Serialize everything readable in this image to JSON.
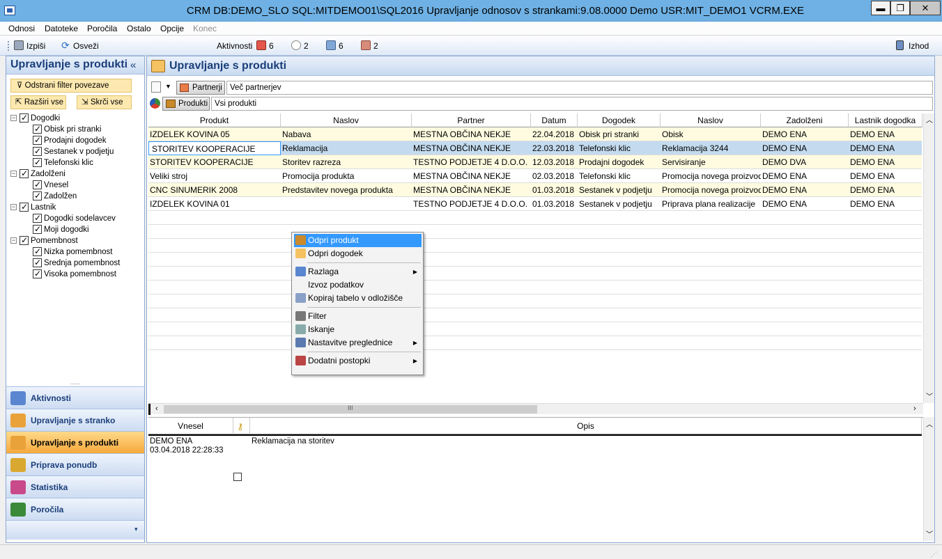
{
  "window": {
    "title": "CRM   DB:DEMO_SLO   SQL:MITDEMO01\\SQL2016   Upravljanje odnosov s strankami:9.08.0000   Demo   USR:MIT_DEMO1   VCRM.EXE",
    "min": "▬",
    "max": "❐",
    "close": "✕"
  },
  "menu": [
    "Odnosi",
    "Datoteke",
    "Poročila",
    "Ostalo",
    "Opcije",
    "Konec"
  ],
  "toolbar": {
    "print": "Izpiši",
    "refresh": "Osveži",
    "activities": "Aktivnosti",
    "count1": "6",
    "count2": "2",
    "count3": "6",
    "count4": "2",
    "exit": "Izhod"
  },
  "left": {
    "title": "Upravljanje s produkti",
    "collapse": "«",
    "remove_filter": "Odstrani filter povezave",
    "expand_all": "Razširi vse",
    "collapse_all": "Skrči vse",
    "tree": [
      {
        "label": "Dogodki",
        "level": 0
      },
      {
        "label": "Obisk pri stranki",
        "level": 1
      },
      {
        "label": "Prodajni dogodek",
        "level": 1
      },
      {
        "label": "Sestanek v podjetju",
        "level": 1
      },
      {
        "label": "Telefonski klic",
        "level": 1
      },
      {
        "label": "Zadolženi",
        "level": 0
      },
      {
        "label": "Vnesel",
        "level": 1
      },
      {
        "label": "Zadolžen",
        "level": 1
      },
      {
        "label": "Lastnik",
        "level": 0
      },
      {
        "label": "Dogodki sodelavcev",
        "level": 1
      },
      {
        "label": "Moji dogodki",
        "level": 1
      },
      {
        "label": "Pomembnost",
        "level": 0
      },
      {
        "label": "Nizka pomembnost",
        "level": 1
      },
      {
        "label": "Srednja pomembnost",
        "level": 1
      },
      {
        "label": "Visoka pomembnost",
        "level": 1
      }
    ],
    "splitter": "......",
    "nav": [
      "Aktivnosti",
      "Upravljanje s stranko",
      "Upravljanje s produkti",
      "Priprava ponudb",
      "Statistika",
      "Poročila"
    ],
    "more": "▾"
  },
  "main": {
    "title": "Upravljanje s produkti",
    "partners_btn": "Partnerji",
    "partners_val": "Več partnerjev",
    "products_btn": "Produkti",
    "products_val": "Vsi produkti",
    "columns": [
      "Produkt",
      "Naslov",
      "Partner",
      "Datum",
      "Dogodek",
      "Naslov",
      "Zadolženi",
      "Lastnik dogodka"
    ],
    "rows": [
      [
        "IZDELEK KOVINA 05",
        "Nabava",
        "MESTNA OBČINA NEKJE",
        "22.04.2018",
        "Obisk pri stranki",
        "Obisk",
        "DEMO ENA",
        "DEMO ENA"
      ],
      [
        "STORITEV KOOPERACIJE",
        "Reklamacija",
        "MESTNA OBČINA NEKJE",
        "22.03.2018",
        "Telefonski klic",
        "Reklamacija 3244",
        "DEMO ENA",
        "DEMO ENA"
      ],
      [
        "STORITEV KOOPERACIJE",
        "Storitev razreza",
        "TESTNO PODJETJE 4 D.O.O.",
        "12.03.2018",
        "Prodajni dogodek",
        "Servisiranje",
        "DEMO DVA",
        "DEMO ENA"
      ],
      [
        "Veliki stroj",
        "Promocija produkta",
        "MESTNA OBČINA NEKJE",
        "02.03.2018",
        "Telefonski klic",
        "Promocija novega proizvoda",
        "DEMO ENA",
        "DEMO ENA"
      ],
      [
        "CNC SINUMERIK 2008",
        "Predstavitev novega produkta",
        "MESTNA OBČINA NEKJE",
        "01.03.2018",
        "Sestanek v podjetju",
        "Promocija novega proizvoda",
        "DEMO ENA",
        "DEMO ENA"
      ],
      [
        "IZDELEK KOVINA 01",
        "",
        "TESTNO PODJETJE 4 D.O.O.",
        "01.03.2018",
        "Sestanek v podjetju",
        "Priprava plana realizacije",
        "DEMO ENA",
        "DEMO ENA"
      ]
    ],
    "scroll_grip": "III",
    "bottom_columns": [
      "Vnesel",
      "Opis"
    ],
    "bottom_user": "DEMO ENA",
    "bottom_date": "03.04.2018 22:28:33",
    "bottom_desc": "Reklamacija na storitev"
  },
  "context_menu": [
    {
      "label": "Odpri produkt",
      "icon": "product-icon",
      "highlight": true
    },
    {
      "label": "Odpri dogodek",
      "icon": "event-icon"
    },
    {
      "sep": true
    },
    {
      "label": "Razlaga",
      "icon": "explain-icon",
      "submenu": true
    },
    {
      "label": "Izvoz podatkov"
    },
    {
      "label": "Kopiraj tabelo v odložišče",
      "icon": "copy-icon"
    },
    {
      "sep": true
    },
    {
      "label": "Filter",
      "icon": "filter-icon"
    },
    {
      "label": "Iskanje",
      "icon": "search-icon"
    },
    {
      "label": "Nastavitve preglednice",
      "icon": "settings-icon",
      "submenu": true
    },
    {
      "sep": true
    },
    {
      "label": "Dodatni postopki",
      "icon": "gear-icon",
      "submenu": true
    }
  ],
  "colors": {
    "accent": "#3399ff",
    "active_nav": "#f6a93b",
    "header_blue": "#1a3e7a",
    "row_alt": "#fefbe0"
  }
}
